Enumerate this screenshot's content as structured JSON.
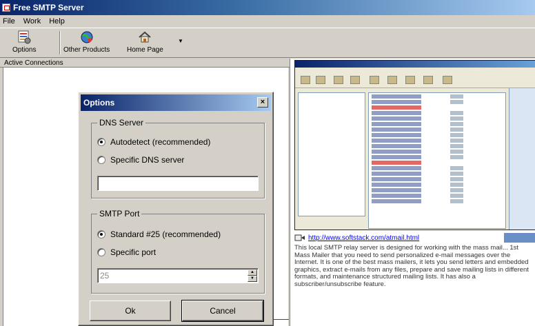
{
  "window": {
    "title": "Free SMTP Server"
  },
  "menu": [
    {
      "label": "File"
    },
    {
      "label": "Work"
    },
    {
      "label": "Help"
    }
  ],
  "toolbar": {
    "options_label": "Options",
    "other_products_label": "Other Products",
    "home_page_label": "Home Page"
  },
  "connections": {
    "header": "Active Connections"
  },
  "promo": {
    "url": "http://www.softstack.com/atmail.html",
    "text": "This local SMTP relay server is designed for working with the mass mail... 1st Mass Mailer that you need to send personalized e-mail messages over the Internet. It is one of the best mass mailers, it lets you send letters and embedded graphics, extract e-mails from any files, prepare and save mailing lists in different formats, and maintenance structured mailing lists. It has also a subscriber/unsubscribe feature."
  },
  "dialog": {
    "title": "Options",
    "close_glyph": "×",
    "dns_group": {
      "legend": "DNS Server",
      "autodetect_label": "Autodetect (recommended)",
      "specific_label": "Specific DNS server",
      "server_value": "",
      "selected": "autodetect"
    },
    "smtp_group": {
      "legend": "SMTP Port",
      "standard_label": "Standard #25 (recommended)",
      "specific_label": "Specific port",
      "port_value": "25",
      "selected": "standard"
    },
    "ok_label": "Ok",
    "cancel_label": "Cancel"
  },
  "icons": {
    "options": "options-icon",
    "other_products": "globe-icon",
    "home_page": "home-icon",
    "link": "link-icon"
  }
}
